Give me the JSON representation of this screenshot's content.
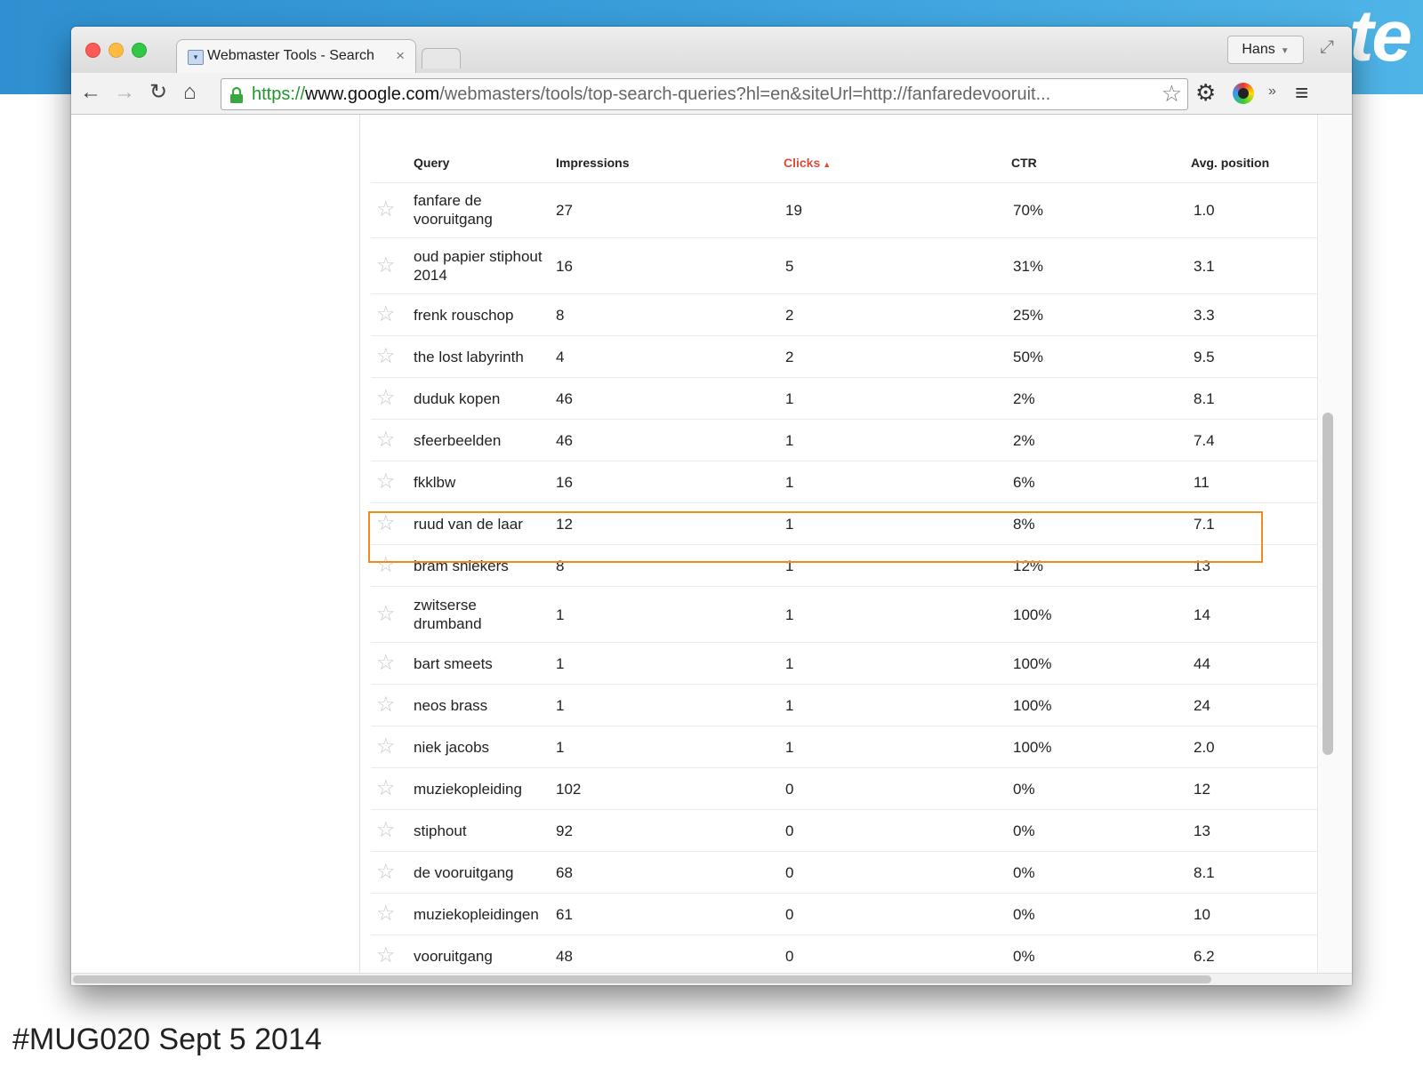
{
  "slide": {
    "footer": "#MUG020 Sept 5 2014",
    "brand_fragment": "te"
  },
  "browser": {
    "tab_title": "Webmaster Tools - Search",
    "tab_close": "×",
    "profile_name": "Hans",
    "url_scheme": "https://",
    "url_host": "www.google.com",
    "url_path": "/webmasters/tools/top-search-queries?hl=en&siteUrl=http://fanfaredevooruit...",
    "icons": {
      "back": "←",
      "forward": "→",
      "reload": "↻",
      "home": "⌂",
      "star": "☆",
      "gear": "⚙",
      "overflow": "»",
      "menu": "≡",
      "fullscreen": "⤢"
    }
  },
  "table": {
    "headers": {
      "query": "Query",
      "impressions": "Impressions",
      "clicks": "Clicks",
      "ctr": "CTR",
      "avg_position": "Avg. position"
    },
    "sorted_column": "Clicks",
    "sort_direction": "descending",
    "highlighted_row": "fkklbw",
    "highlight_color": "#f28b1e",
    "rows": [
      {
        "query": "fanfare de vooruitgang",
        "impressions": "27",
        "clicks": "19",
        "ctr": "70%",
        "position": "1.0",
        "tall": true
      },
      {
        "query": "oud papier stiphout 2014",
        "impressions": "16",
        "clicks": "5",
        "ctr": "31%",
        "position": "3.1",
        "tall": true
      },
      {
        "query": "frenk rouschop",
        "impressions": "8",
        "clicks": "2",
        "ctr": "25%",
        "position": "3.3"
      },
      {
        "query": "the lost labyrinth",
        "impressions": "4",
        "clicks": "2",
        "ctr": "50%",
        "position": "9.5"
      },
      {
        "query": "duduk kopen",
        "impressions": "46",
        "clicks": "1",
        "ctr": "2%",
        "position": "8.1"
      },
      {
        "query": "sfeerbeelden",
        "impressions": "46",
        "clicks": "1",
        "ctr": "2%",
        "position": "7.4"
      },
      {
        "query": "fkklbw",
        "impressions": "16",
        "clicks": "1",
        "ctr": "6%",
        "position": "11"
      },
      {
        "query": "ruud van de laar",
        "impressions": "12",
        "clicks": "1",
        "ctr": "8%",
        "position": "7.1"
      },
      {
        "query": "bram sniekers",
        "impressions": "8",
        "clicks": "1",
        "ctr": "12%",
        "position": "13"
      },
      {
        "query": "zwitserse drumband",
        "impressions": "1",
        "clicks": "1",
        "ctr": "100%",
        "position": "14",
        "tall": true
      },
      {
        "query": "bart smeets",
        "impressions": "1",
        "clicks": "1",
        "ctr": "100%",
        "position": "44"
      },
      {
        "query": "neos brass",
        "impressions": "1",
        "clicks": "1",
        "ctr": "100%",
        "position": "24"
      },
      {
        "query": "niek jacobs",
        "impressions": "1",
        "clicks": "1",
        "ctr": "100%",
        "position": "2.0"
      },
      {
        "query": "muziekopleiding",
        "impressions": "102",
        "clicks": "0",
        "ctr": "0%",
        "position": "12"
      },
      {
        "query": "stiphout",
        "impressions": "92",
        "clicks": "0",
        "ctr": "0%",
        "position": "13"
      },
      {
        "query": "de vooruitgang",
        "impressions": "68",
        "clicks": "0",
        "ctr": "0%",
        "position": "8.1"
      },
      {
        "query": "muziekopleidingen",
        "impressions": "61",
        "clicks": "0",
        "ctr": "0%",
        "position": "10"
      },
      {
        "query": "vooruitgang",
        "impressions": "48",
        "clicks": "0",
        "ctr": "0%",
        "position": "6.2"
      }
    ]
  }
}
